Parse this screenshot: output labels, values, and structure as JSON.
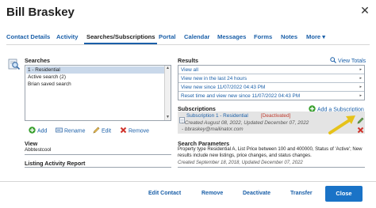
{
  "header": {
    "title": "Bill Braskey",
    "close_glyph": "✕"
  },
  "tabs": [
    {
      "label": "Contact Details"
    },
    {
      "label": "Activity"
    },
    {
      "label": "Searches/Subscriptions",
      "active": true
    },
    {
      "label": "Portal"
    },
    {
      "label": "Calendar"
    },
    {
      "label": "Messages"
    },
    {
      "label": "Forms"
    },
    {
      "label": "Notes"
    },
    {
      "label": "More ▾"
    }
  ],
  "searches": {
    "heading": "Searches",
    "items": [
      "1 - Residential",
      "Active search (2)",
      "Brian saved search"
    ],
    "selected_index": 0,
    "buttons": {
      "add": "Add",
      "rename": "Rename",
      "edit": "Edit",
      "remove": "Remove"
    }
  },
  "view": {
    "heading": "View",
    "value": "Abbtestcool"
  },
  "listing_activity": {
    "heading": "Listing Activity Report"
  },
  "results": {
    "heading": "Results",
    "view_totals": "View Totals",
    "options": [
      "View all",
      "View new in the last 24 hours",
      "View new since 11/07/2022 04:43 PM",
      "Reset time and view new since 11/07/2022 04:43 PM"
    ]
  },
  "subscriptions": {
    "heading": "Subscriptions",
    "add_link": "Add a Subscription",
    "item": {
      "name": "Subscription 1 - Residential",
      "status": "[Deactivated]",
      "created": "- Created August 08, 2022, Updated December 07, 2022",
      "email": "- bbraskey@mailinator.com"
    }
  },
  "search_parameters": {
    "heading": "Search Parameters",
    "text": [
      "Property type Residential A, List Price between 100 and 400000, Status of 'Active'; New",
      "results include new listings, price changes, and status changes."
    ],
    "created": "Created September 18, 2018, Updated December 07, 2022"
  },
  "footer": {
    "edit_contact": "Edit Contact",
    "remove": "Remove",
    "deactivate": "Deactivate",
    "transfer": "Transfer",
    "close": "Close"
  },
  "colors": {
    "link": "#1a5fa8",
    "primary_button": "#1a73c7",
    "annotation_arrow": "#e6c21a",
    "status_deactivated": "#c0392b"
  }
}
